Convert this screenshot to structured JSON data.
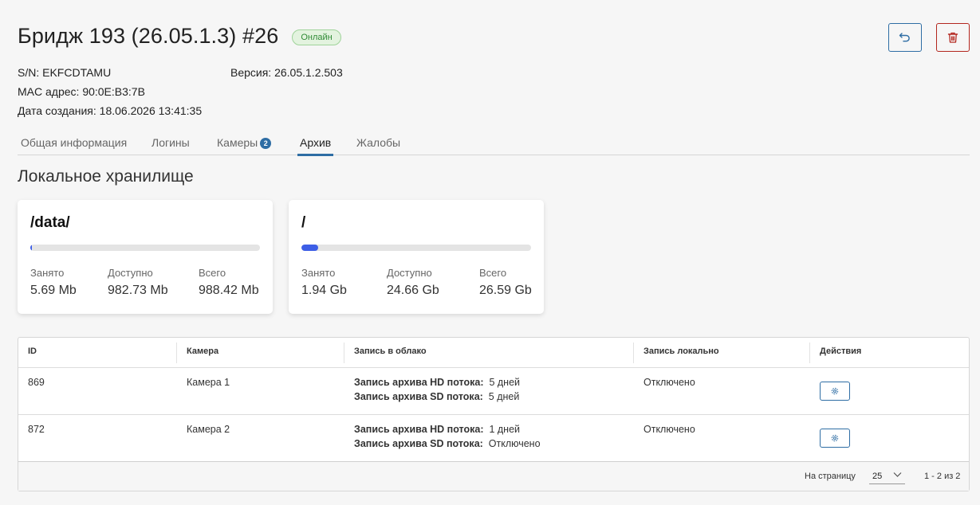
{
  "header": {
    "title": "Бридж 193 (26.05.1.3) #26",
    "status": "Онлайн"
  },
  "info": {
    "sn_label": "S/N:",
    "sn_value": "EKFCDTAMU",
    "mac_label": "MAC адрес:",
    "mac_value": "90:0E:B3:7B",
    "created_label": "Дата создания:",
    "created_value": "18.06.2026 13:41:35",
    "version_label": "Версия:",
    "version_value": "26.05.1.2.503"
  },
  "tabs": [
    {
      "label": "Общая информация"
    },
    {
      "label": "Логины"
    },
    {
      "label": "Камеры",
      "count": "2"
    },
    {
      "label": "Архив"
    },
    {
      "label": "Жалобы"
    }
  ],
  "active_tab": "Архив",
  "section_title": "Локальное хранилище",
  "storage": [
    {
      "path": "/data/",
      "used_label": "Занято",
      "used": "5.69 Mb",
      "free_label": "Доступно",
      "free": "982.73 Mb",
      "total_label": "Всего",
      "total": "988.42 Mb",
      "fill_fraction": 0.006
    },
    {
      "path": "/",
      "used_label": "Занято",
      "used": "1.94 Gb",
      "free_label": "Доступно",
      "free": "24.66 Gb",
      "total_label": "Всего",
      "total": "26.59 Gb",
      "fill_fraction": 0.073
    }
  ],
  "table": {
    "columns": [
      "ID",
      "Камера",
      "Запись в облако",
      "Запись локально",
      "Действия"
    ],
    "rows": [
      {
        "id": "869",
        "camera": "Камера 1",
        "hd_label": "Запись архива HD потока:",
        "hd_value": "5 дней",
        "sd_label": "Запись архива SD потока:",
        "sd_value": "5 дней",
        "local": "Отключено"
      },
      {
        "id": "872",
        "camera": "Камера 2",
        "hd_label": "Запись архива HD потока:",
        "hd_value": "1 дней",
        "sd_label": "Запись архива SD потока:",
        "sd_value": "Отключено",
        "local": "Отключено"
      }
    ],
    "footer": {
      "per_page_label": "На страницу",
      "per_page_value": "25",
      "range": "1 - 2 из 2"
    }
  },
  "icons": {
    "undo": "undo-icon",
    "delete": "trash-icon",
    "settings": "gear-icon",
    "dropdown": "chevron-down-icon"
  },
  "colors": {
    "accent": "#2e6da4",
    "danger": "#b3261e",
    "online_bg": "#e3f3df",
    "online_text": "#2f8a35",
    "progress": "#3d5ee6"
  }
}
